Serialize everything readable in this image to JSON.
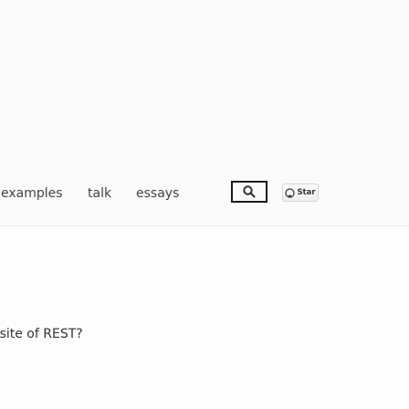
{
  "nav": {
    "links": [
      {
        "label": "examples"
      },
      {
        "label": "talk"
      },
      {
        "label": "essays"
      }
    ],
    "search_icon": "search-icon",
    "star_button": {
      "icon": "github-octocat-icon",
      "label": "Star"
    }
  },
  "content": {
    "text": "osite of REST?"
  },
  "colors": {
    "navbar_bg": "#fafafa",
    "text": "#444444",
    "search_border": "#1a1a1a"
  }
}
